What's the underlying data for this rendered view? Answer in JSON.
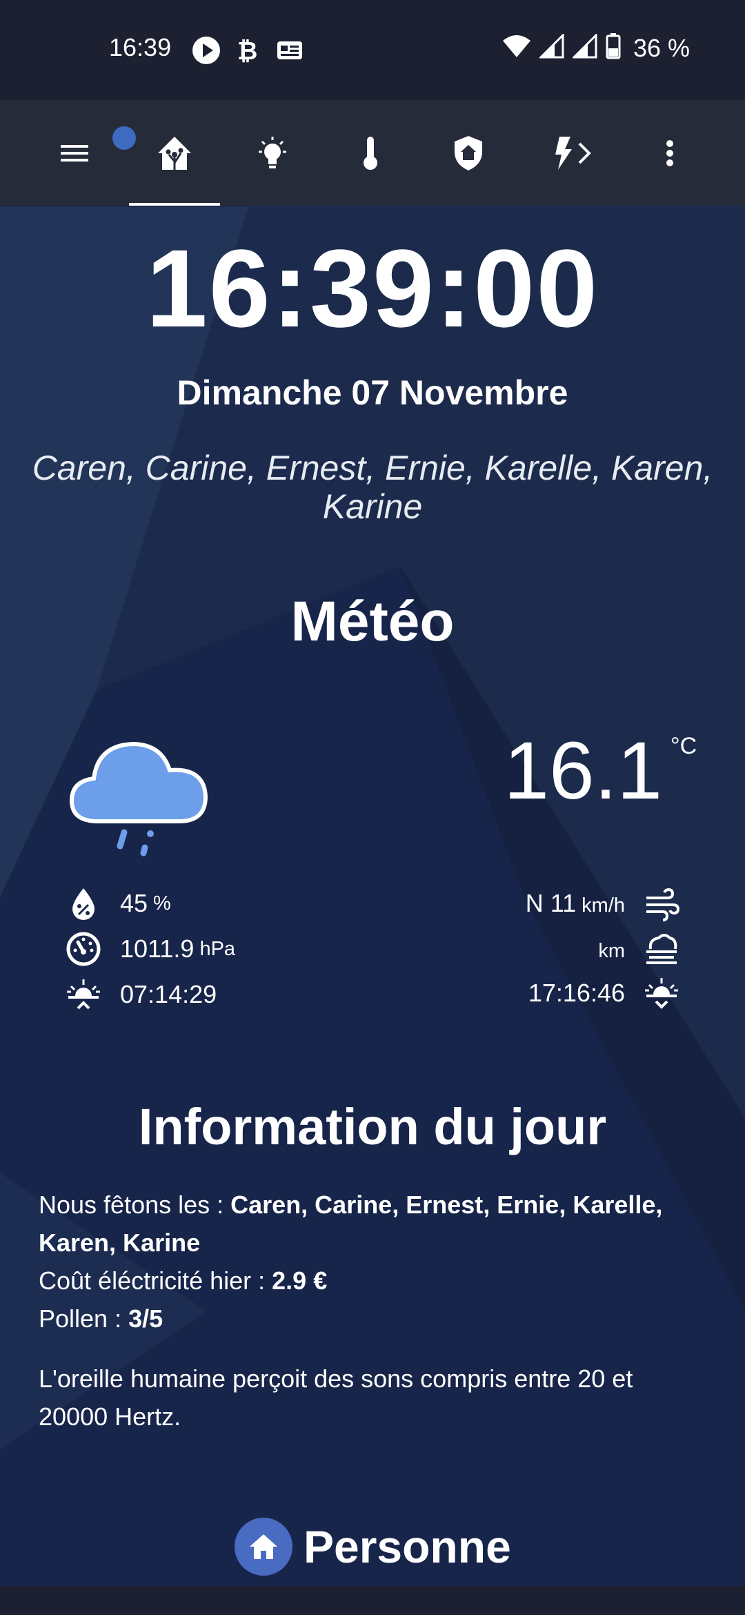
{
  "status_bar": {
    "time": "16:39",
    "battery_text": "36 %",
    "icons_left": [
      "play-icon",
      "bitcoin-icon",
      "news-icon"
    ],
    "icons_right": [
      "wifi-icon",
      "signal-icon",
      "signal-icon",
      "battery-icon"
    ]
  },
  "toolbar": {
    "tabs": [
      {
        "name": "menu-icon",
        "active": false
      },
      {
        "name": "home-assistant-icon",
        "active": true
      },
      {
        "name": "lightbulb-icon",
        "active": false
      },
      {
        "name": "thermometer-icon",
        "active": false
      },
      {
        "name": "shield-home-icon",
        "active": false
      },
      {
        "name": "lightning-icon",
        "active": false
      },
      {
        "name": "chevron-right-icon",
        "active": false
      },
      {
        "name": "more-vertical-icon",
        "active": false
      }
    ]
  },
  "clock": {
    "time": "16:39:00",
    "date": "Dimanche 07 Novembre",
    "names": "Caren, Carine, Ernest, Ernie, Karelle, Karen, Karine"
  },
  "meteo": {
    "title": "Météo",
    "condition_icon": "rainy-cloud-icon",
    "temperature": "16.1",
    "temperature_unit": "°C",
    "humidity_value": "45",
    "humidity_unit": "%",
    "pressure_value": "1011.9",
    "pressure_unit": "hPa",
    "sunrise": "07:14:29",
    "wind_value": "N 11",
    "wind_unit": "km/h",
    "visibility_unit": "km",
    "sunset": "17:16:46"
  },
  "info": {
    "title": "Information du jour",
    "names_label": "Nous fêtons les : ",
    "names_value": "Caren, Carine, Ernest, Ernie, Karelle, Karen, Karine",
    "cost_label": "Coût éléctricité hier : ",
    "cost_value": "2.9 €",
    "pollen_label": "Pollen : ",
    "pollen_value": "3/5",
    "fact": "L'oreille humaine perçoit des sons compris entre 20 et 20000 Hertz."
  },
  "personne": {
    "label": "Personne"
  },
  "colors": {
    "background": "#1a2744",
    "status_bar": "#1c2030",
    "toolbar": "#262b3a",
    "accent": "#4a6bc2",
    "weather_icon": "#6c9eea"
  }
}
